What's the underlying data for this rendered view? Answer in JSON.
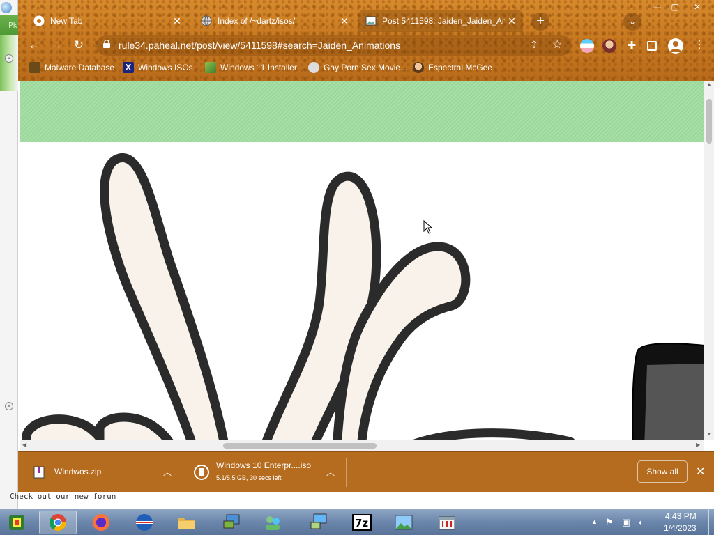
{
  "desktop": {
    "pk_text": "Pk",
    "forum_notice": "Check out our new forun"
  },
  "tabs": [
    {
      "label": "New Tab",
      "active": false
    },
    {
      "label": "Index of /~dartz/isos/",
      "active": false
    },
    {
      "label": "Post 5411598: Jaiden_Jaiden_An",
      "active": true
    }
  ],
  "window_controls": {
    "minimize": "—",
    "maximize": "▢",
    "close": "✕"
  },
  "toolbar": {
    "url": "rule34.paheal.net/post/view/5411598#search=Jaiden_Animations"
  },
  "bookmarks": [
    {
      "label": "Malware Database",
      "icon": "malware-icon"
    },
    {
      "label": "Windows ISOs",
      "icon": "x-icon"
    },
    {
      "label": "Windows 11 Installer",
      "icon": "installer-icon"
    },
    {
      "label": "Gay Porn Sex Movie...",
      "icon": "site-icon"
    },
    {
      "label": "Espectral McGee",
      "icon": "avatar-icon"
    }
  ],
  "downloads": {
    "items": [
      {
        "name": "Windwos.zip",
        "status": ""
      },
      {
        "name": "Windows 10 Enterpr....iso",
        "status": "5.1/5.5 GB, 30 secs left"
      }
    ],
    "show_all_label": "Show all"
  },
  "taskbar": {
    "apps": [
      "start",
      "chrome",
      "firefox",
      "opera",
      "file-explorer",
      "remote-desktop",
      "people-network",
      "network-computer",
      "7zip",
      "photo-viewer",
      "app-manager"
    ],
    "time": "4:43 PM",
    "date": "1/4/2023"
  },
  "colors": {
    "titlebar": "#c97a21",
    "shelf": "#b56c1e",
    "banner_green": "#a8e0a8",
    "taskbar": "#6b86ab"
  }
}
